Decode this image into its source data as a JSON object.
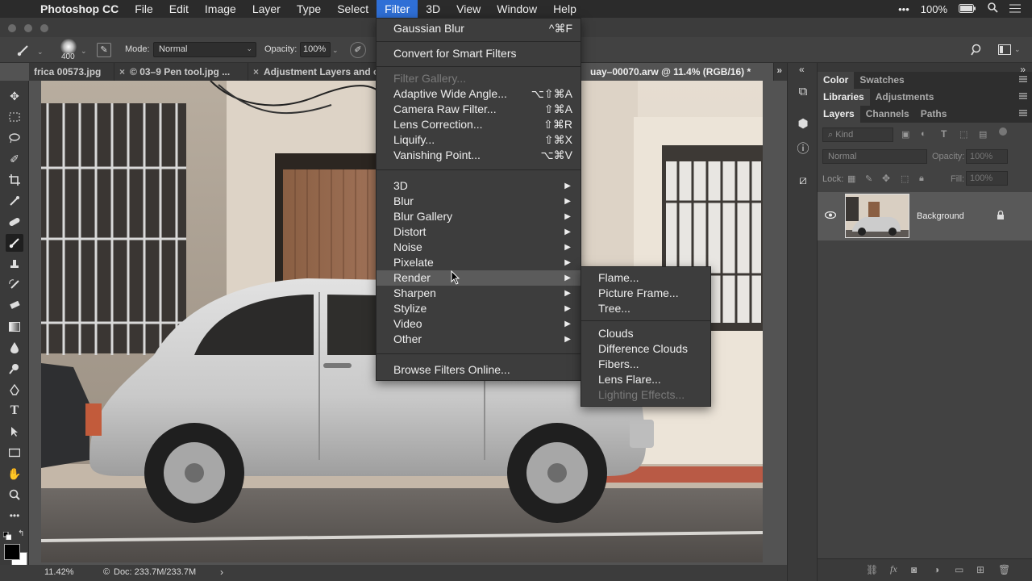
{
  "menubar": {
    "app": "Photoshop CC",
    "items": [
      "File",
      "Edit",
      "Image",
      "Layer",
      "Type",
      "Select",
      "Filter",
      "3D",
      "View",
      "Window",
      "Help"
    ],
    "active": "Filter",
    "battery": "100%"
  },
  "options": {
    "brush_size": "400",
    "mode_label": "Mode:",
    "mode_value": "Normal",
    "opacity_label": "Opacity:",
    "opacity_value": "100%"
  },
  "tabs": [
    {
      "label": "frica 00573.jpg"
    },
    {
      "label": "© 03–9 Pen tool.jpg ..."
    },
    {
      "label": "Adjustment Layers and o"
    },
    {
      "label": "uay–00070.arw @ 11.4% (RGB/16) *"
    }
  ],
  "filter_menu": {
    "items": [
      {
        "label": "Gaussian Blur",
        "shortcut": "^⌘F"
      },
      {
        "label": "Convert for Smart Filters",
        "shortcut": ""
      },
      {
        "label": "Filter Gallery...",
        "shortcut": "",
        "disabled": true
      },
      {
        "label": "Adaptive Wide Angle...",
        "shortcut": "⌥⇧⌘A"
      },
      {
        "label": "Camera Raw Filter...",
        "shortcut": "⇧⌘A"
      },
      {
        "label": "Lens Correction...",
        "shortcut": "⇧⌘R"
      },
      {
        "label": "Liquify...",
        "shortcut": "⇧⌘X"
      },
      {
        "label": "Vanishing Point...",
        "shortcut": "⌥⌘V"
      },
      {
        "label": "3D"
      },
      {
        "label": "Blur"
      },
      {
        "label": "Blur Gallery"
      },
      {
        "label": "Distort"
      },
      {
        "label": "Noise"
      },
      {
        "label": "Pixelate"
      },
      {
        "label": "Render",
        "highlighted": true
      },
      {
        "label": "Sharpen"
      },
      {
        "label": "Stylize"
      },
      {
        "label": "Video"
      },
      {
        "label": "Other"
      },
      {
        "label": "Browse Filters Online..."
      }
    ]
  },
  "render_submenu": {
    "items": [
      {
        "label": "Flame..."
      },
      {
        "label": "Picture Frame..."
      },
      {
        "label": "Tree..."
      },
      {
        "label": "Clouds"
      },
      {
        "label": "Difference Clouds"
      },
      {
        "label": "Fibers..."
      },
      {
        "label": "Lens Flare..."
      },
      {
        "label": "Lighting Effects...",
        "disabled": true
      }
    ]
  },
  "panels": {
    "color_tabs": [
      "Color",
      "Swatches"
    ],
    "lib_tabs": [
      "Libraries",
      "Adjustments"
    ],
    "layer_tabs": [
      "Layers",
      "Channels",
      "Paths"
    ],
    "kind_label": "Kind",
    "blend_mode": "Normal",
    "opacity_label": "Opacity:",
    "opacity_value": "100%",
    "lock_label": "Lock:",
    "fill_label": "Fill:",
    "fill_value": "100%",
    "layer_name": "Background"
  },
  "status": {
    "zoom": "11.42%",
    "doc": "Doc: 233.7M/233.7M"
  }
}
